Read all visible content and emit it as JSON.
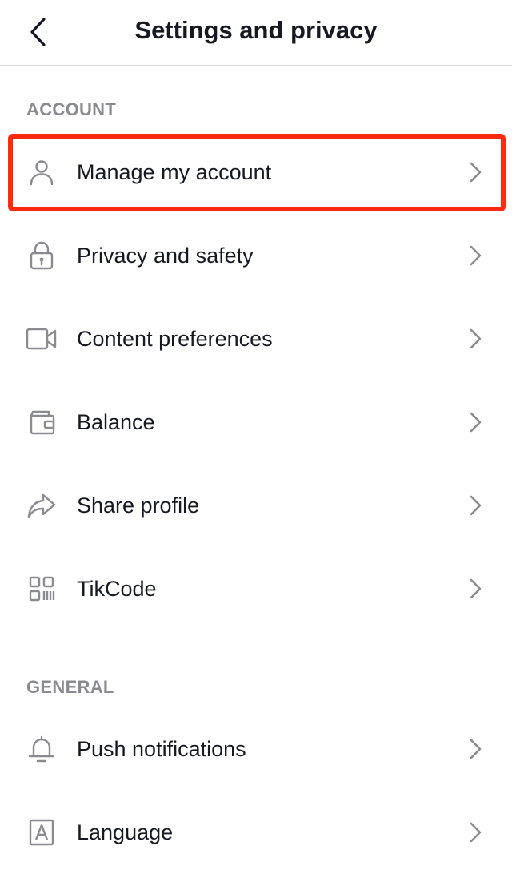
{
  "header": {
    "title": "Settings and privacy",
    "back_icon": "chevron-left-icon"
  },
  "sections": [
    {
      "label": "ACCOUNT",
      "items": [
        {
          "label": "Manage my account",
          "icon": "person-icon",
          "highlighted": true
        },
        {
          "label": "Privacy and safety",
          "icon": "lock-icon"
        },
        {
          "label": "Content preferences",
          "icon": "video-camera-icon"
        },
        {
          "label": "Balance",
          "icon": "wallet-icon"
        },
        {
          "label": "Share profile",
          "icon": "share-arrow-icon"
        },
        {
          "label": "TikCode",
          "icon": "qr-code-icon"
        }
      ]
    },
    {
      "label": "GENERAL",
      "items": [
        {
          "label": "Push notifications",
          "icon": "bell-icon"
        },
        {
          "label": "Language",
          "icon": "language-icon"
        }
      ]
    }
  ],
  "colors": {
    "highlight_border": "#ff2a10",
    "icon_gray": "#8a8b91",
    "text": "#161823"
  }
}
